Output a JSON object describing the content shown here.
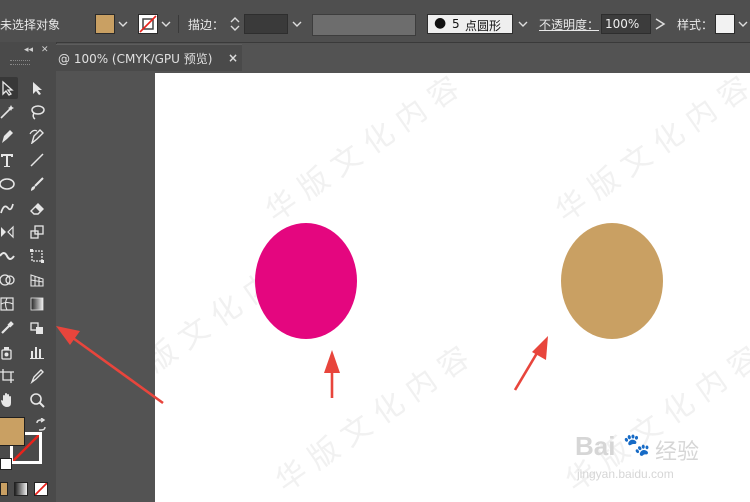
{
  "control_bar": {
    "selection_status": "未选择对象",
    "fill_color": "#c9a063",
    "stroke_label": "描边：",
    "brush_size": "5",
    "brush_shape": "点圆形",
    "opacity_label": "不透明度：",
    "opacity_value": "100%",
    "style_label": "样式："
  },
  "document": {
    "tab_title": "@ 100% (CMYK/GPU 预览)",
    "close_icon_label": "×",
    "shapes": [
      {
        "name": "magenta-circle",
        "fill": "#e4067f"
      },
      {
        "name": "tan-circle",
        "fill": "#c9a063"
      }
    ],
    "arrow_color": "#e8453c"
  },
  "toolbox": {
    "fill_swatch_color": "#c9a063",
    "tools": [
      "selection-tool",
      "direct-selection-tool",
      "magic-wand-tool",
      "lasso-tool",
      "pen-tool",
      "curvature-tool",
      "type-tool",
      "line-segment-tool",
      "ellipse-tool",
      "paintbrush-tool",
      "shaper-tool",
      "eraser-tool",
      "reflect-tool",
      "scale-tool",
      "width-tool",
      "free-transform-tool",
      "shape-builder-tool",
      "perspective-grid-tool",
      "mesh-tool",
      "gradient-tool",
      "eyedropper-tool",
      "live-paint-bucket-tool",
      "symbol-sprayer-tool",
      "column-graph-tool",
      "artboard-tool",
      "slice-tool",
      "hand-tool",
      "zoom-tool"
    ]
  },
  "watermarks": {
    "baidu_logo": "Bai",
    "baidu_logo_suffix": "经验",
    "baidu_url": "jingyan.baidu.com"
  }
}
